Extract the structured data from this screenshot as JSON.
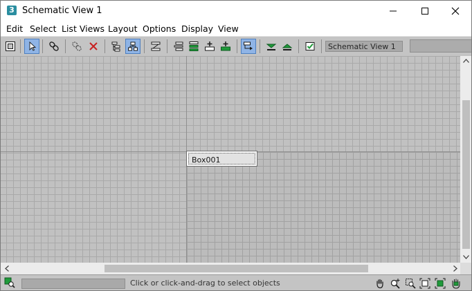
{
  "window": {
    "title": "Schematic View 1",
    "app_icon_glyph": "3",
    "app_icon_color": "#2a8ea0",
    "controls": [
      "minimize-icon",
      "maximize-icon",
      "close-icon"
    ]
  },
  "menu": [
    "Edit",
    "Select",
    "List Views",
    "Layout",
    "Options",
    "Display",
    "View"
  ],
  "toolbar": {
    "view_name": "Schematic View 1",
    "buttons": [
      "display-floater-icon",
      "select-icon",
      "connect-icon",
      "unlink-selected-icon",
      "delete-objects-icon",
      "hierarchy-mode-icon",
      "references-mode-icon",
      "free-all-icon",
      "shrink-selected-icon",
      "align-selected-icon",
      "expand-selected-icon",
      "collapse-selected-icon",
      "arrange-children-icon",
      "preferences-icon",
      "move-down-icon",
      "move-up-icon",
      "show-floater-check-icon"
    ],
    "active": [
      "select-icon",
      "references-mode-icon",
      "arrange-children-icon"
    ]
  },
  "canvas": {
    "nodes": [
      {
        "label": "Box001"
      }
    ]
  },
  "statusbar": {
    "prompt": "Click or click-and-drag to select objects",
    "nav_icons": [
      "pan-icon",
      "zoom-icon",
      "zoom-region-icon",
      "zoom-extents-icon",
      "zoom-extents-selected-icon",
      "pan-to-selected-icon"
    ]
  },
  "colors": {
    "toolbar_bg": "#c4c4c4",
    "canvas_bg": "#c1c1c1",
    "active_button": "#8fb4e6",
    "green_accent": "#1f9a3a"
  }
}
